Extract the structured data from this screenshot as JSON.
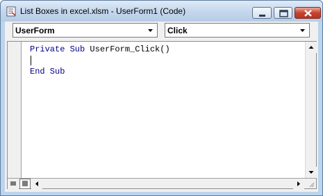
{
  "window": {
    "title": "List Boxes in excel.xlsm - UserForm1 (Code)",
    "controls": {
      "minimize": "minimize",
      "maximize": "maximize",
      "close": "close"
    }
  },
  "toolbar": {
    "object_combo": {
      "value": "UserForm"
    },
    "procedure_combo": {
      "value": "Click"
    }
  },
  "code": {
    "lines": [
      {
        "keyword": "Private Sub",
        "text": " UserForm_Click()"
      },
      {
        "keyword": "",
        "text": ""
      },
      {
        "keyword": "End Sub",
        "text": ""
      }
    ]
  },
  "colors": {
    "keyword": "#00008b",
    "titlebar": "#c3d6ec",
    "close_button": "#c7432f"
  }
}
